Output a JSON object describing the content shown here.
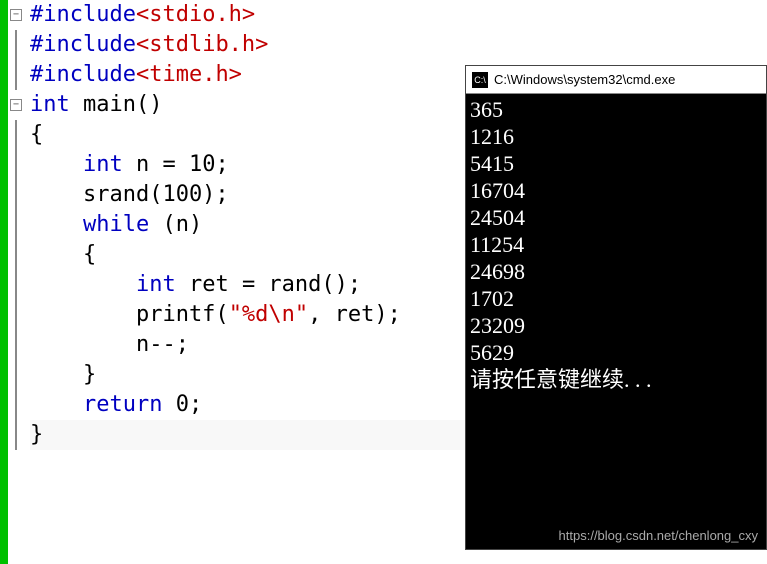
{
  "code": {
    "lines": [
      {
        "fold": "minus",
        "tokens": [
          {
            "cls": "kw-inc",
            "t": "#include"
          },
          {
            "cls": "kw-hdr",
            "t": "<stdio.h>"
          }
        ]
      },
      {
        "fold": "line",
        "tokens": [
          {
            "cls": "kw-inc",
            "t": "#include"
          },
          {
            "cls": "kw-hdr",
            "t": "<stdlib.h>"
          }
        ]
      },
      {
        "fold": "line",
        "tokens": [
          {
            "cls": "kw-inc",
            "t": "#include"
          },
          {
            "cls": "kw-hdr",
            "t": "<time.h>"
          }
        ]
      },
      {
        "fold": "minus",
        "tokens": [
          {
            "cls": "kw-type",
            "t": "int"
          },
          {
            "cls": "",
            "t": " "
          },
          {
            "cls": "kw-ident",
            "t": "main()"
          }
        ]
      },
      {
        "fold": "line",
        "tokens": [
          {
            "cls": "",
            "t": "{"
          }
        ]
      },
      {
        "fold": "line",
        "tokens": [
          {
            "cls": "",
            "t": "    "
          },
          {
            "cls": "kw-type",
            "t": "int"
          },
          {
            "cls": "",
            "t": " n = 10;"
          }
        ]
      },
      {
        "fold": "line",
        "tokens": [
          {
            "cls": "",
            "t": "    srand(100);"
          }
        ]
      },
      {
        "fold": "line",
        "tokens": [
          {
            "cls": "",
            "t": "    "
          },
          {
            "cls": "kw-ctrl",
            "t": "while"
          },
          {
            "cls": "",
            "t": " (n)"
          }
        ]
      },
      {
        "fold": "line",
        "tokens": [
          {
            "cls": "",
            "t": "    {"
          }
        ]
      },
      {
        "fold": "line",
        "tokens": [
          {
            "cls": "",
            "t": "        "
          },
          {
            "cls": "kw-type",
            "t": "int"
          },
          {
            "cls": "",
            "t": " ret = rand();"
          }
        ]
      },
      {
        "fold": "line",
        "tokens": [
          {
            "cls": "",
            "t": "        printf("
          },
          {
            "cls": "kw-str",
            "t": "\"%d\\n\""
          },
          {
            "cls": "",
            "t": ", ret);"
          }
        ]
      },
      {
        "fold": "line",
        "tokens": [
          {
            "cls": "",
            "t": "        n--;"
          }
        ]
      },
      {
        "fold": "line",
        "tokens": [
          {
            "cls": "",
            "t": "    }"
          }
        ]
      },
      {
        "fold": "line",
        "tokens": [
          {
            "cls": "",
            "t": "    "
          },
          {
            "cls": "kw-ctrl",
            "t": "return"
          },
          {
            "cls": "",
            "t": " 0;"
          }
        ]
      },
      {
        "fold": "line",
        "current": true,
        "tokens": [
          {
            "cls": "",
            "t": "}"
          }
        ]
      }
    ]
  },
  "console": {
    "title": "C:\\Windows\\system32\\cmd.exe",
    "icon_label": "C:\\",
    "output_lines": [
      "365",
      "1216",
      "5415",
      "16704",
      "24504",
      "11254",
      "24698",
      "1702",
      "23209",
      "5629",
      "请按任意键继续. . ."
    ]
  },
  "watermark": "https://blog.csdn.net/chenlong_cxy"
}
